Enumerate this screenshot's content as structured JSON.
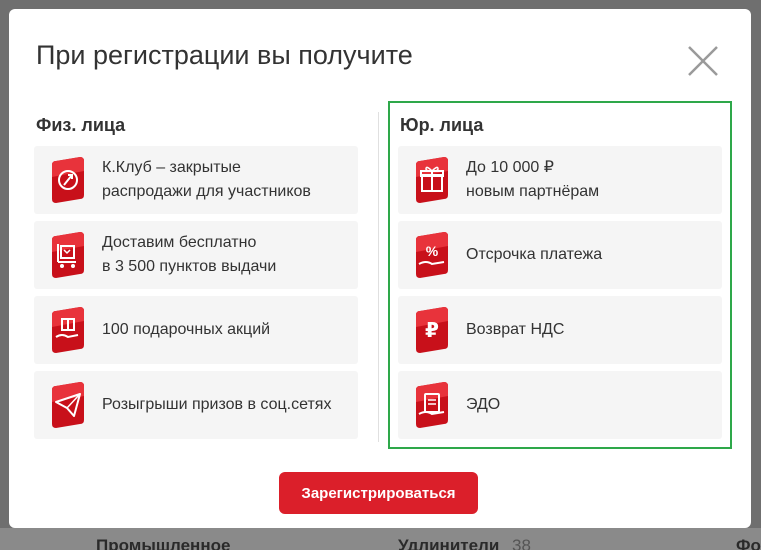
{
  "modal": {
    "title": "При регистрации вы получите",
    "close_icon": "close-icon",
    "register_button": "Зарегистрироваться"
  },
  "individuals": {
    "title": "Физ. лица",
    "items": [
      {
        "icon": "rocket-icon",
        "lines": [
          "К.Клуб – закрытые",
          "распродажи для участников"
        ]
      },
      {
        "icon": "delivery-icon",
        "lines": [
          "Доставим бесплатно",
          "в 3 500 пунктов выдачи"
        ]
      },
      {
        "icon": "gift-hand-icon",
        "lines": [
          "100 подарочных акций"
        ]
      },
      {
        "icon": "send-icon",
        "lines": [
          "Розыгрыши призов в соц.сетях"
        ]
      }
    ]
  },
  "legal": {
    "title": "Юр. лица",
    "items": [
      {
        "icon": "gift-icon",
        "lines": [
          "До 10 000 ₽",
          "новым партнёрам"
        ]
      },
      {
        "icon": "percent-icon",
        "lines": [
          "Отсрочка платежа"
        ]
      },
      {
        "icon": "ruble-icon",
        "lines": [
          "Возврат НДС"
        ]
      },
      {
        "icon": "document-icon",
        "lines": [
          "ЭДО"
        ]
      }
    ]
  },
  "background": {
    "fragments": [
      "Промышленное",
      "Удлинители",
      "38",
      "Фо"
    ]
  },
  "colors": {
    "accent": "#db1f2a",
    "highlight_border": "#2ea84a",
    "card_bg": "#f5f5f5"
  }
}
